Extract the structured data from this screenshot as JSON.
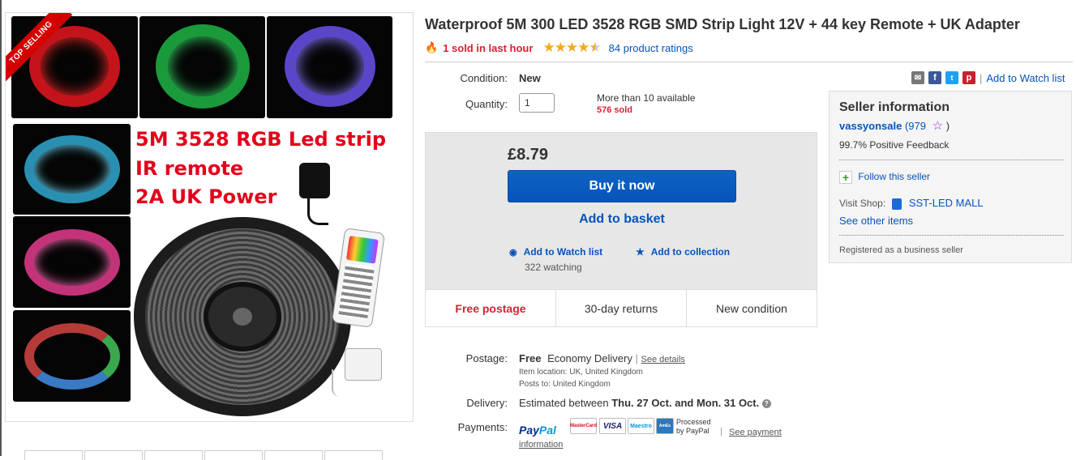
{
  "gallery": {
    "badge": "TOP SELLING",
    "promo_lines": [
      "5M 3528  RGB Led strip",
      "IR remote",
      "2A UK Power"
    ]
  },
  "listing": {
    "title": "Waterproof 5M 300 LED 3528 RGB SMD Strip Light 12V + 44 key Remote + UK Adapter",
    "sold_text": "1 sold in last hour",
    "rating_stars": "4.5",
    "ratings_text": "84 product ratings"
  },
  "details": {
    "condition_label": "Condition:",
    "condition_value": "New",
    "quantity_label": "Quantity:",
    "quantity_value": "1",
    "available_text": "More than 10 available",
    "sold_count": "576 sold"
  },
  "share": {
    "watch_link": "Add to Watch list"
  },
  "buybox": {
    "price": "£8.79",
    "buy_now": "Buy it now",
    "add_to_basket": "Add to basket",
    "add_watch": "Add to Watch list",
    "add_collection": "Add to collection",
    "watching": "322 watching",
    "features": [
      "Free postage",
      "30-day returns",
      "New condition"
    ]
  },
  "shipping": {
    "postage_label": "Postage:",
    "postage_free": "Free",
    "postage_service": "Economy Delivery",
    "see_details": "See details",
    "item_location": "Item location:  UK, United Kingdom",
    "posts_to": "Posts to:  United Kingdom",
    "delivery_label": "Delivery:",
    "delivery_prefix": "Estimated between",
    "delivery_dates": "Thu. 27 Oct. and Mon. 31 Oct.",
    "payments_label": "Payments:",
    "paypal_a": "Pay",
    "paypal_b": "Pal",
    "processed_by": [
      "Processed",
      "by PayPal"
    ],
    "see_payment_a": "See payment",
    "see_payment_b": "information",
    "cards": [
      "MasterCard",
      "VISA",
      "Maestro",
      "AmEx"
    ]
  },
  "seller": {
    "title": "Seller information",
    "name": "vassyonsale",
    "score_open": "(979",
    "score_close": ")",
    "feedback": "99.7% Positive Feedback",
    "follow": "Follow this seller",
    "visit_shop_label": "Visit Shop:",
    "shop_name": "SST-LED MALL",
    "see_other": "See other items",
    "registered": "Registered as a business seller"
  },
  "colors": {
    "ebay_blue": "#0654ba",
    "red_text": "#dd1e31",
    "star_gold": "#f5a623"
  }
}
